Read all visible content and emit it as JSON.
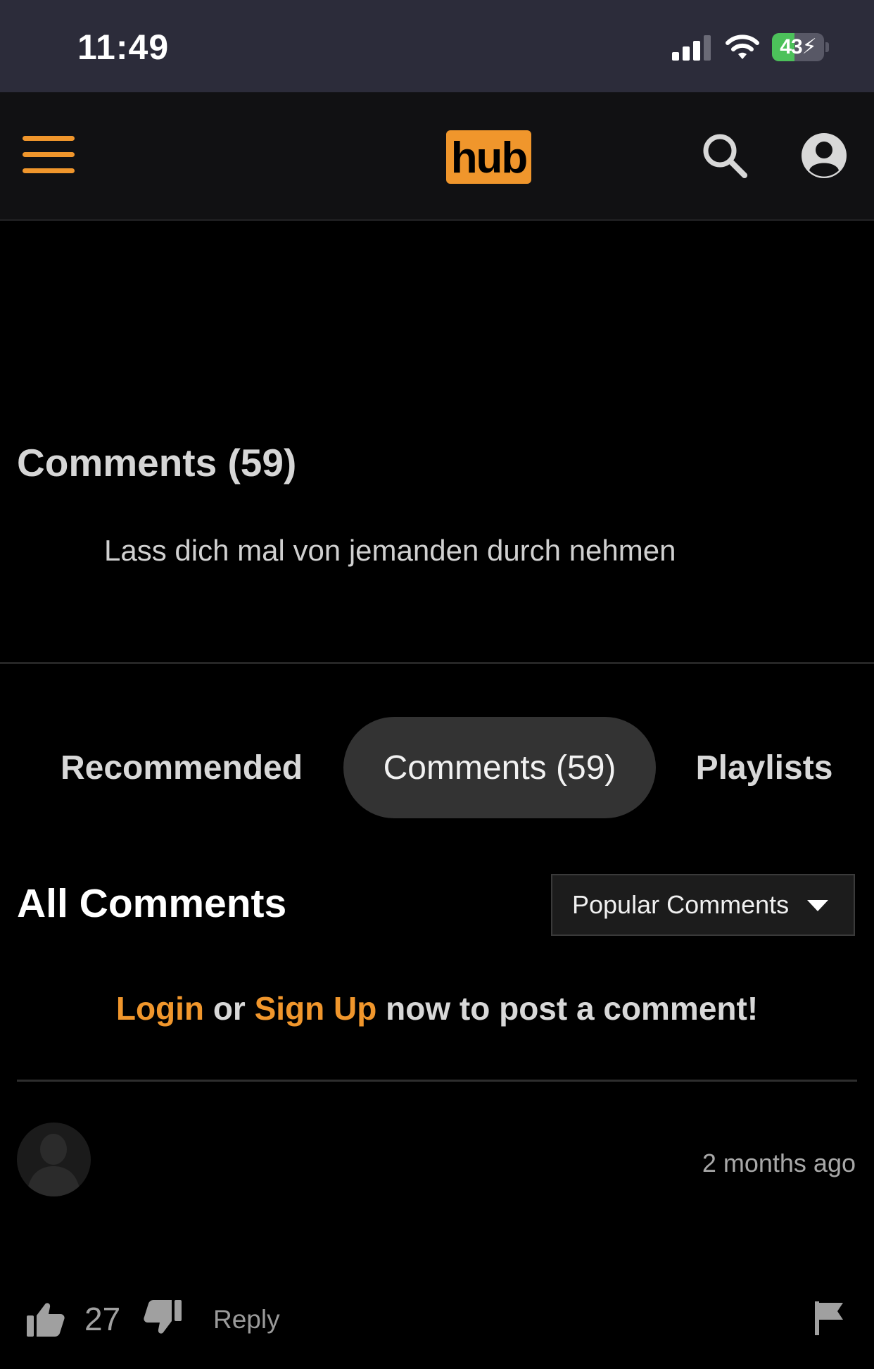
{
  "status_bar": {
    "time": "11:49",
    "battery_percent": "43",
    "battery_level": 0.43,
    "icons": [
      "cellular-signal-icon",
      "wifi-icon",
      "battery-charging-icon"
    ]
  },
  "header": {
    "logo_text": "hub",
    "icons": [
      "hamburger-menu-icon",
      "search-icon",
      "account-icon"
    ],
    "accent_color": "#f0962c"
  },
  "description": {
    "title": "Comments (59)",
    "text": "Lass dich mal von jemanden durch nehmen"
  },
  "tabs": [
    {
      "label": "Recommended",
      "active": false
    },
    {
      "label": "Comments (59)",
      "active": true
    },
    {
      "label": "Playlists",
      "active": false
    }
  ],
  "comments_section": {
    "title": "All Comments",
    "sort_selected": "Popular Comments",
    "login_prompt": {
      "login": "Login",
      "or": "or",
      "signup": "Sign Up",
      "rest": "now to post a comment!"
    }
  },
  "comment": {
    "time": "2 months ago",
    "likes": "27",
    "reply_label": "Reply"
  }
}
